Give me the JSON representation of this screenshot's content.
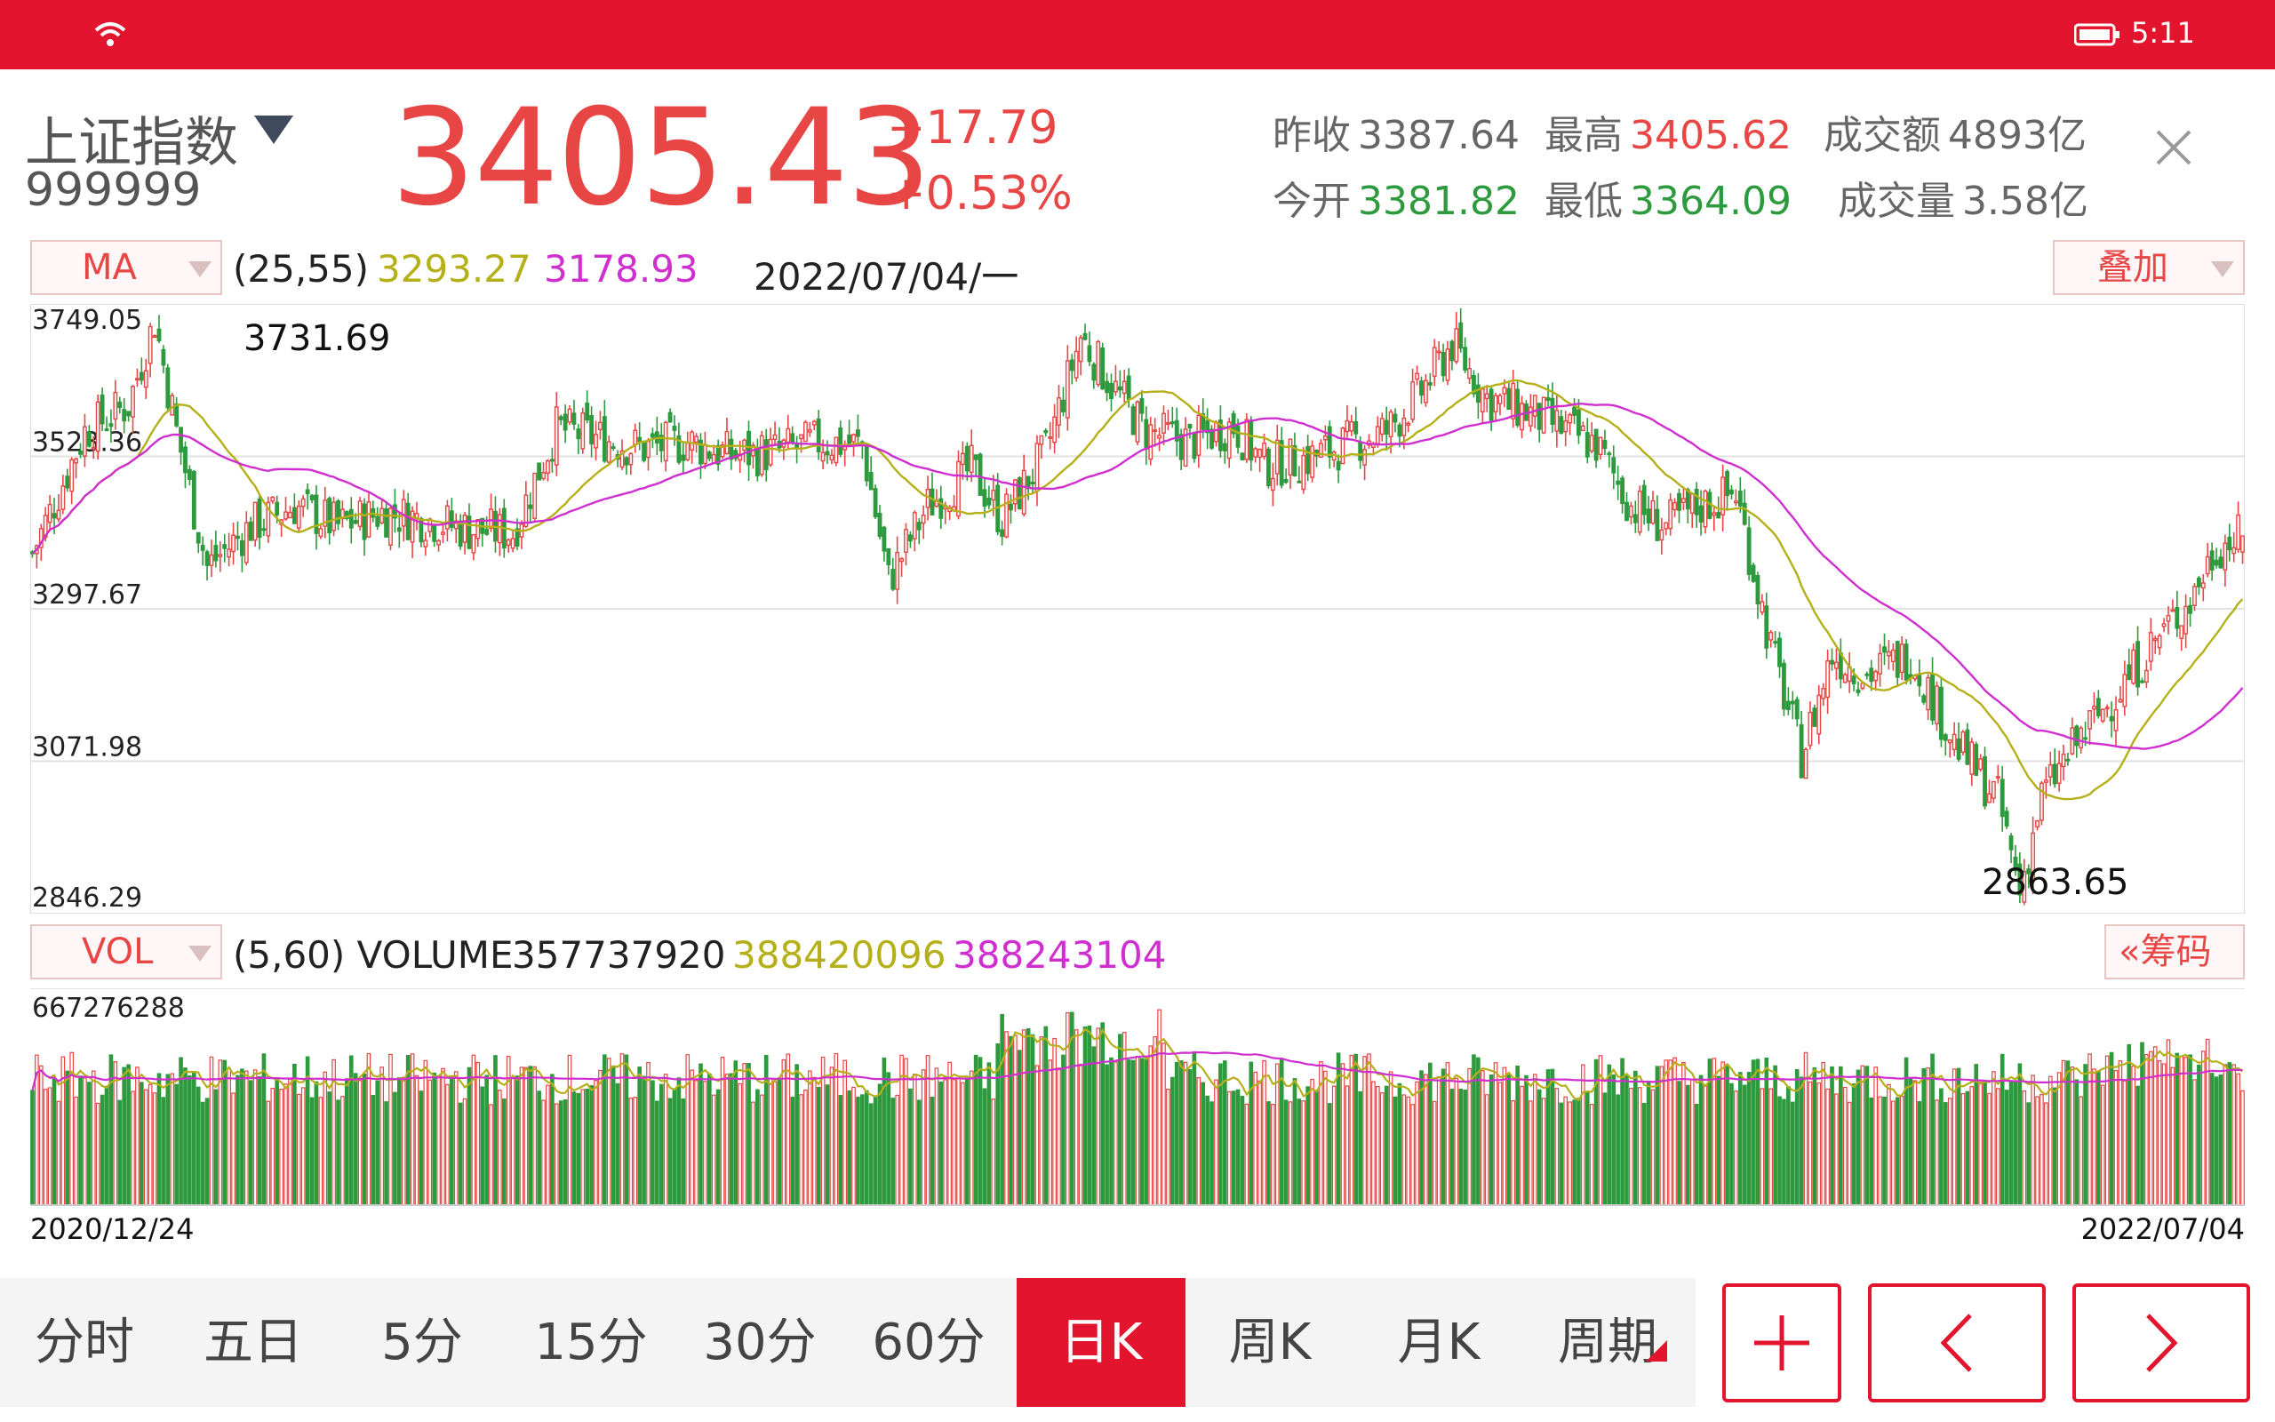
{
  "status_bar": {
    "time": "5:11"
  },
  "header": {
    "index_name": "上证指数",
    "index_code": "999999",
    "price": "3405.43",
    "change": "+17.79",
    "change_pct": "+0.53%",
    "stats": [
      {
        "label": "昨收",
        "value": "3387.64",
        "color": "gray"
      },
      {
        "label": "最高",
        "value": "3405.62",
        "color": "red"
      },
      {
        "label": "成交额",
        "value": "4893亿",
        "color": "gray"
      },
      {
        "label": "今开",
        "value": "3381.82",
        "color": "green"
      },
      {
        "label": "最低",
        "value": "3364.09",
        "color": "green"
      },
      {
        "label": "成交量",
        "value": "3.58亿",
        "color": "gray"
      }
    ]
  },
  "ma_bar": {
    "selector": "MA",
    "params": "(25,55)",
    "ma1": "3293.27",
    "ma2": "3178.93",
    "date": "2022/07/04/一",
    "overlay_button": "叠加"
  },
  "vol_bar": {
    "selector": "VOL",
    "params": "(5,60) VOLUME",
    "volume": "357737920",
    "ma1": "388420096",
    "ma2": "388243104",
    "chips_button": "筹码"
  },
  "colors": {
    "up": "#e84545",
    "down": "#2c9a3d",
    "ma1": "#b5b019",
    "ma2": "#d02fd0",
    "accent": "#e3142e"
  },
  "chart_data": {
    "type": "candlestick",
    "price_ticks": [
      "3749.05",
      "3523.36",
      "3297.67",
      "3071.98",
      "2846.29"
    ],
    "ylim": [
      2846.29,
      3749.05
    ],
    "high_label": "3731.69",
    "low_label": "2863.65",
    "x_start_label": "2020/12/24",
    "x_end_label": "2022/07/04",
    "volume_max_label": "667276288",
    "volume_ylim": [
      0,
      667276288
    ],
    "close_path": [
      [
        0,
        3380
      ],
      [
        12,
        3560
      ],
      [
        22,
        3600
      ],
      [
        28,
        3725
      ],
      [
        33,
        3560
      ],
      [
        40,
        3360
      ],
      [
        50,
        3420
      ],
      [
        60,
        3450
      ],
      [
        70,
        3420
      ],
      [
        80,
        3440
      ],
      [
        90,
        3430
      ],
      [
        100,
        3415
      ],
      [
        110,
        3410
      ],
      [
        120,
        3565
      ],
      [
        130,
        3550
      ],
      [
        140,
        3535
      ],
      [
        150,
        3545
      ],
      [
        160,
        3525
      ],
      [
        170,
        3530
      ],
      [
        180,
        3545
      ],
      [
        190,
        3540
      ],
      [
        196,
        3340
      ],
      [
        205,
        3450
      ],
      [
        215,
        3505
      ],
      [
        222,
        3430
      ],
      [
        232,
        3530
      ],
      [
        240,
        3700
      ],
      [
        248,
        3620
      ],
      [
        255,
        3560
      ],
      [
        265,
        3545
      ],
      [
        275,
        3570
      ],
      [
        282,
        3510
      ],
      [
        292,
        3520
      ],
      [
        300,
        3540
      ],
      [
        310,
        3560
      ],
      [
        318,
        3620
      ],
      [
        325,
        3690
      ],
      [
        333,
        3610
      ],
      [
        342,
        3590
      ],
      [
        350,
        3565
      ],
      [
        358,
        3540
      ],
      [
        366,
        3450
      ],
      [
        374,
        3420
      ],
      [
        382,
        3450
      ],
      [
        390,
        3470
      ],
      [
        398,
        3240
      ],
      [
        405,
        3080
      ],
      [
        412,
        3230
      ],
      [
        420,
        3200
      ],
      [
        430,
        3230
      ],
      [
        440,
        3100
      ],
      [
        450,
        3015
      ],
      [
        455,
        2880
      ],
      [
        460,
        3020
      ],
      [
        468,
        3100
      ],
      [
        478,
        3180
      ],
      [
        486,
        3250
      ],
      [
        494,
        3310
      ],
      [
        500,
        3390
      ],
      [
        506,
        3405
      ]
    ],
    "series": [
      {
        "name": "MA25",
        "last": "3293.27"
      },
      {
        "name": "MA55",
        "last": "3178.93"
      }
    ]
  },
  "bottom_tabs": [
    "分时",
    "五日",
    "5分",
    "15分",
    "30分",
    "60分",
    "日K",
    "周K",
    "月K",
    "周期"
  ],
  "active_tab": "日K"
}
